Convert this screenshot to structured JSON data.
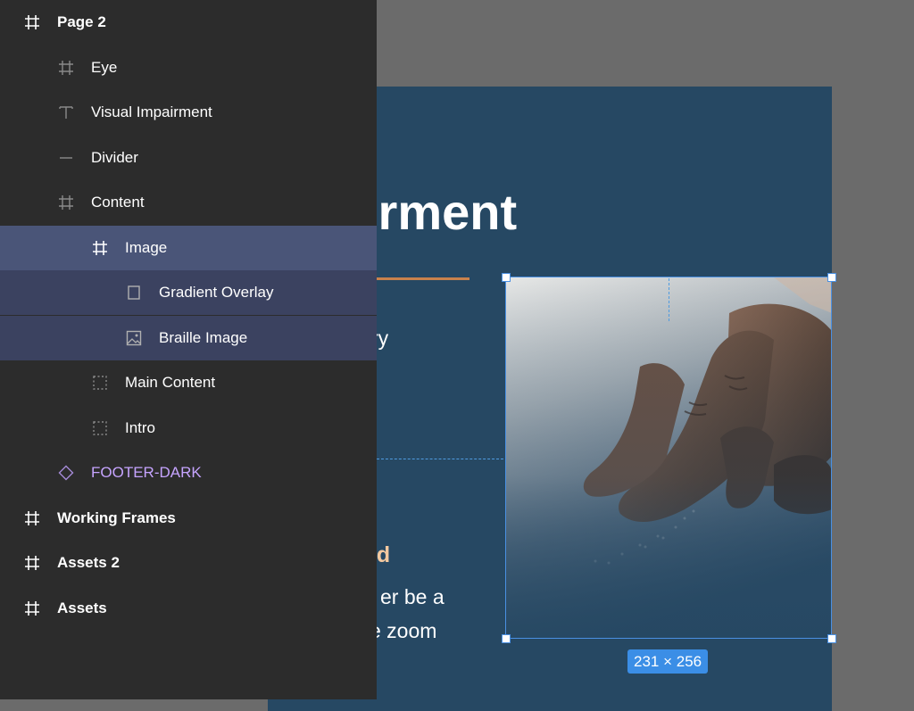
{
  "layers_panel": {
    "items": [
      {
        "label": "Page 2",
        "icon": "frame-icon"
      },
      {
        "label": "Eye",
        "icon": "frame-icon"
      },
      {
        "label": "Visual Impairment",
        "icon": "text-icon"
      },
      {
        "label": "Divider",
        "icon": "line-icon"
      },
      {
        "label": "Content",
        "icon": "frame-icon"
      },
      {
        "label": "Image",
        "icon": "frame-icon",
        "state": "selected"
      },
      {
        "label": "Gradient Overlay",
        "icon": "rectangle-icon"
      },
      {
        "label": "Braille Image",
        "icon": "image-icon"
      },
      {
        "label": "Main Content",
        "icon": "group-icon"
      },
      {
        "label": "Intro",
        "icon": "group-icon"
      },
      {
        "label": "FOOTER-DARK",
        "icon": "component-icon"
      },
      {
        "label": "Working Frames",
        "icon": "frame-icon"
      },
      {
        "label": "Assets 2",
        "icon": "frame-icon"
      },
      {
        "label": "Assets",
        "icon": "frame-icon"
      }
    ]
  },
  "canvas": {
    "heading_fragment": "irment",
    "text_fragment_1": "ry",
    "subheading_fragment": "ed",
    "body_line_1": "er be a",
    "body_line_2": "e zoom",
    "selection_size": "231 × 256"
  },
  "colors": {
    "panel_bg": "#2c2c2c",
    "selected_row": "#4a5578",
    "child_selected_row": "#3b4260",
    "component_text": "#c6a4ff",
    "canvas_bg": "#6b6b6b",
    "frame_bg": "#264863",
    "selection_blue": "#4a90e2",
    "divider_orange": "#c9824c",
    "subheading_peach": "#f3c9a0"
  }
}
